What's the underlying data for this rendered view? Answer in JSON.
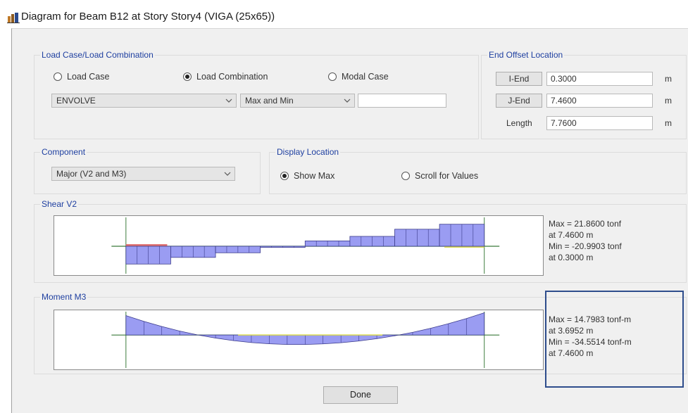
{
  "window": {
    "title": "Diagram for Beam B12 at Story Story4 (VIGA (25x65))",
    "icon": "etabs-app-icon"
  },
  "load_case": {
    "group_label": "Load Case/Load Combination",
    "options": [
      "Load Case",
      "Load Combination",
      "Modal Case"
    ],
    "selected": "Load Combination",
    "combo_value": "ENVOLVE",
    "mode_value": "Max and Min",
    "extra_value": ""
  },
  "end_offset": {
    "group_label": "End Offset Location",
    "i_end_label": "I-End",
    "i_end_value": "0.3000",
    "i_end_unit": "m",
    "j_end_label": "J-End",
    "j_end_value": "7.4600",
    "j_end_unit": "m",
    "length_label": "Length",
    "length_value": "7.7600",
    "length_unit": "m"
  },
  "component": {
    "group_label": "Component",
    "value": "Major (V2 and M3)"
  },
  "display_location": {
    "group_label": "Display Location",
    "options": [
      "Show Max",
      "Scroll for Values"
    ],
    "selected": "Show Max"
  },
  "shear": {
    "group_label": "Shear V2",
    "max_text": "Max = 21.8600 tonf",
    "max_at": "at 7.4600 m",
    "min_text": "Min = -20.9903 tonf",
    "min_at": "at 0.3000 m",
    "unit": "tonf",
    "beam_length_m": 7.76,
    "offset_start_m": 0.3,
    "offset_end_m": 7.46,
    "max_value": 21.86,
    "min_value": -20.9903,
    "steps": [
      -17.7,
      -11.1,
      -6.5,
      -1.2,
      5.3,
      9.8,
      16.9,
      21.86
    ]
  },
  "moment": {
    "group_label": "Moment M3",
    "max_text": "Max = 14.7983 tonf-m",
    "max_at": "at 3.6952 m",
    "min_text": "Min = -34.5514 tonf-m",
    "min_at": "at 7.4600 m",
    "unit": "tonf-m",
    "max_value": 14.7983,
    "max_location_m": 3.6952,
    "min_value": -34.5514,
    "min_location_m": 7.46,
    "start_value": -30.2
  },
  "buttons": {
    "done": "Done"
  },
  "colors": {
    "diagram_fill": "#9a9cf2",
    "diagram_stroke": "#3a3a8a",
    "secondary_red": "#e07070",
    "secondary_yellow": "#d8d84a",
    "axis_green": "#3a7a3a",
    "label_blue": "#1e3fa0",
    "highlight_border": "#2e4d8c"
  }
}
